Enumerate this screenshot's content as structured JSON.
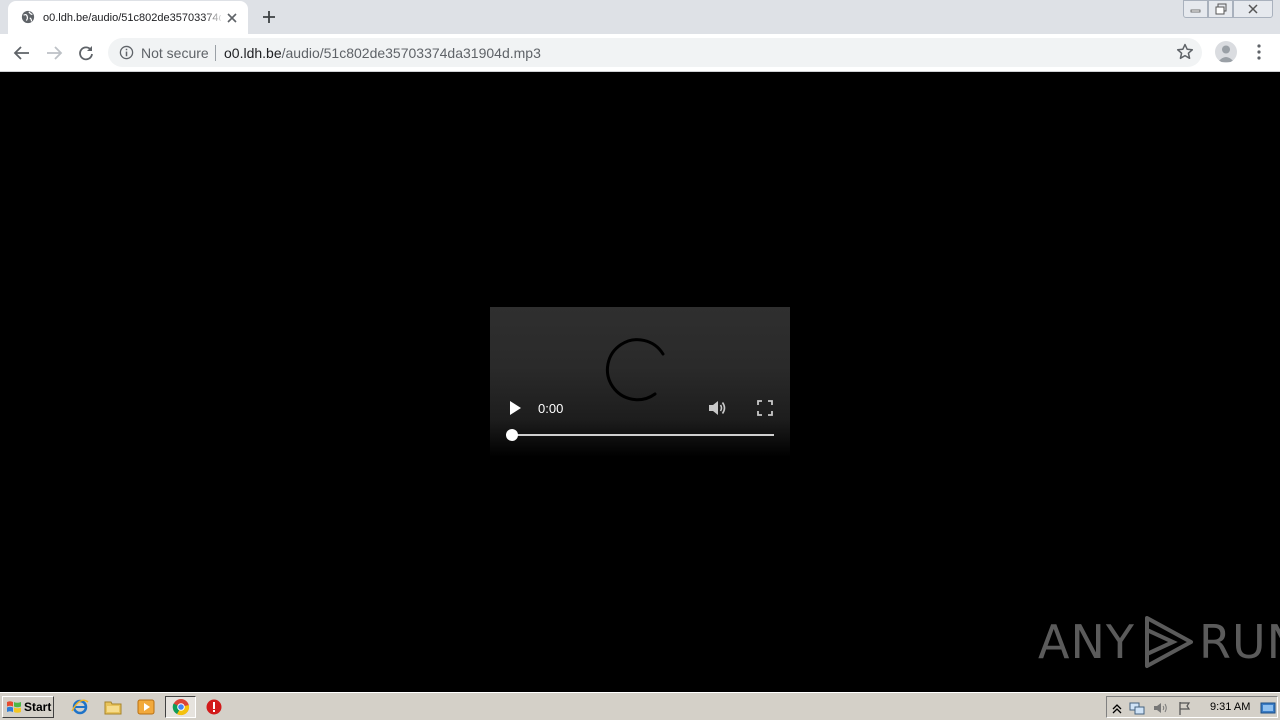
{
  "browser": {
    "tab": {
      "title": "o0.ldh.be/audio/51c802de35703374da31904d.mp3",
      "favicon": "globe-icon"
    },
    "new_tab_icon": "plus-icon",
    "window_controls": [
      "minimize-icon",
      "restore-icon",
      "close-icon"
    ],
    "toolbar": {
      "back_icon": "arrow-left-icon",
      "forward_icon": "arrow-right-icon",
      "reload_icon": "reload-icon",
      "security_label": "Not secure",
      "url_host": "o0.ldh.be",
      "url_path": "/audio/51c802de35703374da31904d.mp3",
      "bookmark_icon": "star-icon",
      "profile_icon": "avatar-icon",
      "menu_icon": "kebab-menu-icon"
    }
  },
  "player": {
    "current_time": "0:00",
    "state": "loading",
    "progress": 0,
    "controls": [
      "play-icon",
      "volume-icon",
      "fullscreen-icon"
    ]
  },
  "watermark": {
    "left_text": "ANY",
    "right_text": "RUN"
  },
  "taskbar": {
    "start_label": "Start",
    "pinned": [
      "internet-explorer-icon",
      "explorer-folder-icon",
      "media-player-icon",
      "chrome-icon",
      "stop-icon"
    ],
    "tray": [
      "show-hidden-icon",
      "network-icon",
      "volume-icon",
      "flag-icon",
      "show-desktop-icon"
    ],
    "clock": "9:31 AM"
  },
  "colors": {
    "tabstrip": "#dee1e6",
    "omnibox": "#f1f3f4",
    "page_background": "#000000",
    "player_panel": "#2f2f2f",
    "taskbar": "#d4d0c8"
  }
}
